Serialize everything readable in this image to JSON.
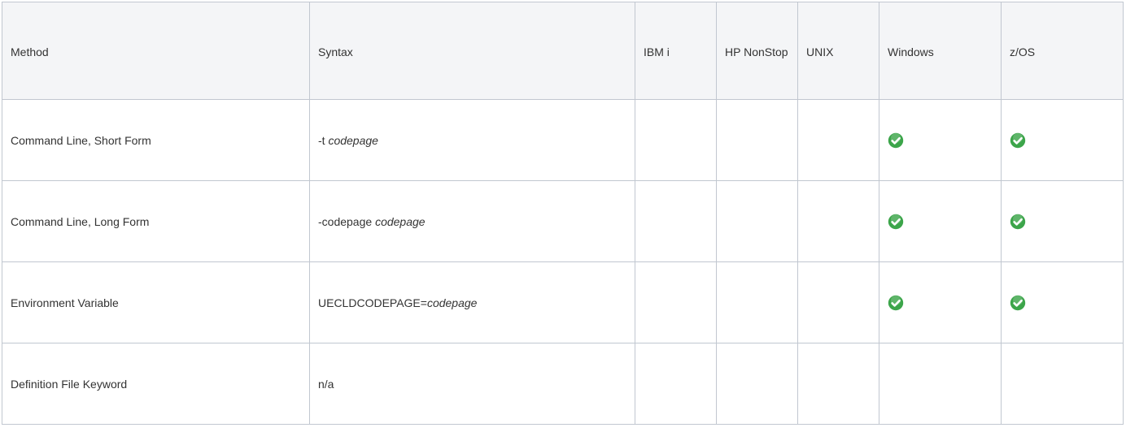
{
  "table": {
    "headers": [
      "Method",
      "Syntax",
      "IBM i",
      "HP NonStop",
      "UNIX",
      "Windows",
      "z/OS"
    ],
    "rows": [
      {
        "method": "Command Line, Short Form",
        "syntax_prefix": "-t ",
        "syntax_var": "codepage",
        "support": [
          false,
          false,
          false,
          true,
          true
        ]
      },
      {
        "method": "Command Line, Long Form",
        "syntax_prefix": "-codepage ",
        "syntax_var": "codepage",
        "support": [
          false,
          false,
          false,
          true,
          true
        ]
      },
      {
        "method": "Environment Variable",
        "syntax_prefix": "UECLDCODEPAGE=",
        "syntax_var": "codepage",
        "support": [
          false,
          false,
          false,
          true,
          true
        ]
      },
      {
        "method": "Definition File Keyword",
        "syntax_prefix": "n/a",
        "syntax_var": "",
        "support": [
          false,
          false,
          false,
          false,
          false
        ]
      }
    ]
  },
  "icons": {
    "supported": "check-circle-icon",
    "supported_color": "#3ca54a"
  }
}
